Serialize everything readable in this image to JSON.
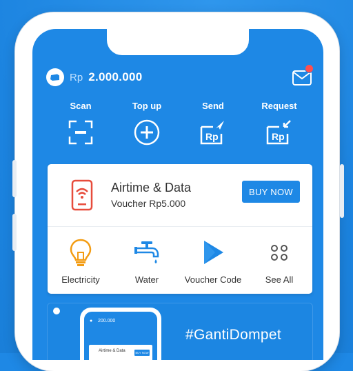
{
  "balance": {
    "currency_prefix": "Rp",
    "amount": "2.000.000"
  },
  "quick_actions": [
    {
      "label": "Scan",
      "icon": "scan-icon"
    },
    {
      "label": "Top up",
      "icon": "plus-circle-icon"
    },
    {
      "label": "Send",
      "icon": "send-rp-icon"
    },
    {
      "label": "Request",
      "icon": "request-rp-icon"
    }
  ],
  "promo": {
    "title": "Airtime & Data",
    "subtitle": "Voucher Rp5.000",
    "button_label": "BUY NOW",
    "icon": "phone-signal-icon"
  },
  "services": [
    {
      "label": "Electricity",
      "icon": "lightbulb-icon"
    },
    {
      "label": "Water",
      "icon": "faucet-icon"
    },
    {
      "label": "Voucher Code",
      "icon": "play-store-icon"
    },
    {
      "label": "See All",
      "icon": "grid-dots-icon"
    }
  ],
  "banner": {
    "hashtag": "#GantiDompet",
    "mini_balance": "200.000",
    "mini_promo_title": "Airtime & Data",
    "mini_button": "BUY NOW"
  },
  "colors": {
    "brand_blue": "#1e88e5",
    "accent_orange": "#f39c12",
    "alert_red": "#ff4f4f"
  }
}
